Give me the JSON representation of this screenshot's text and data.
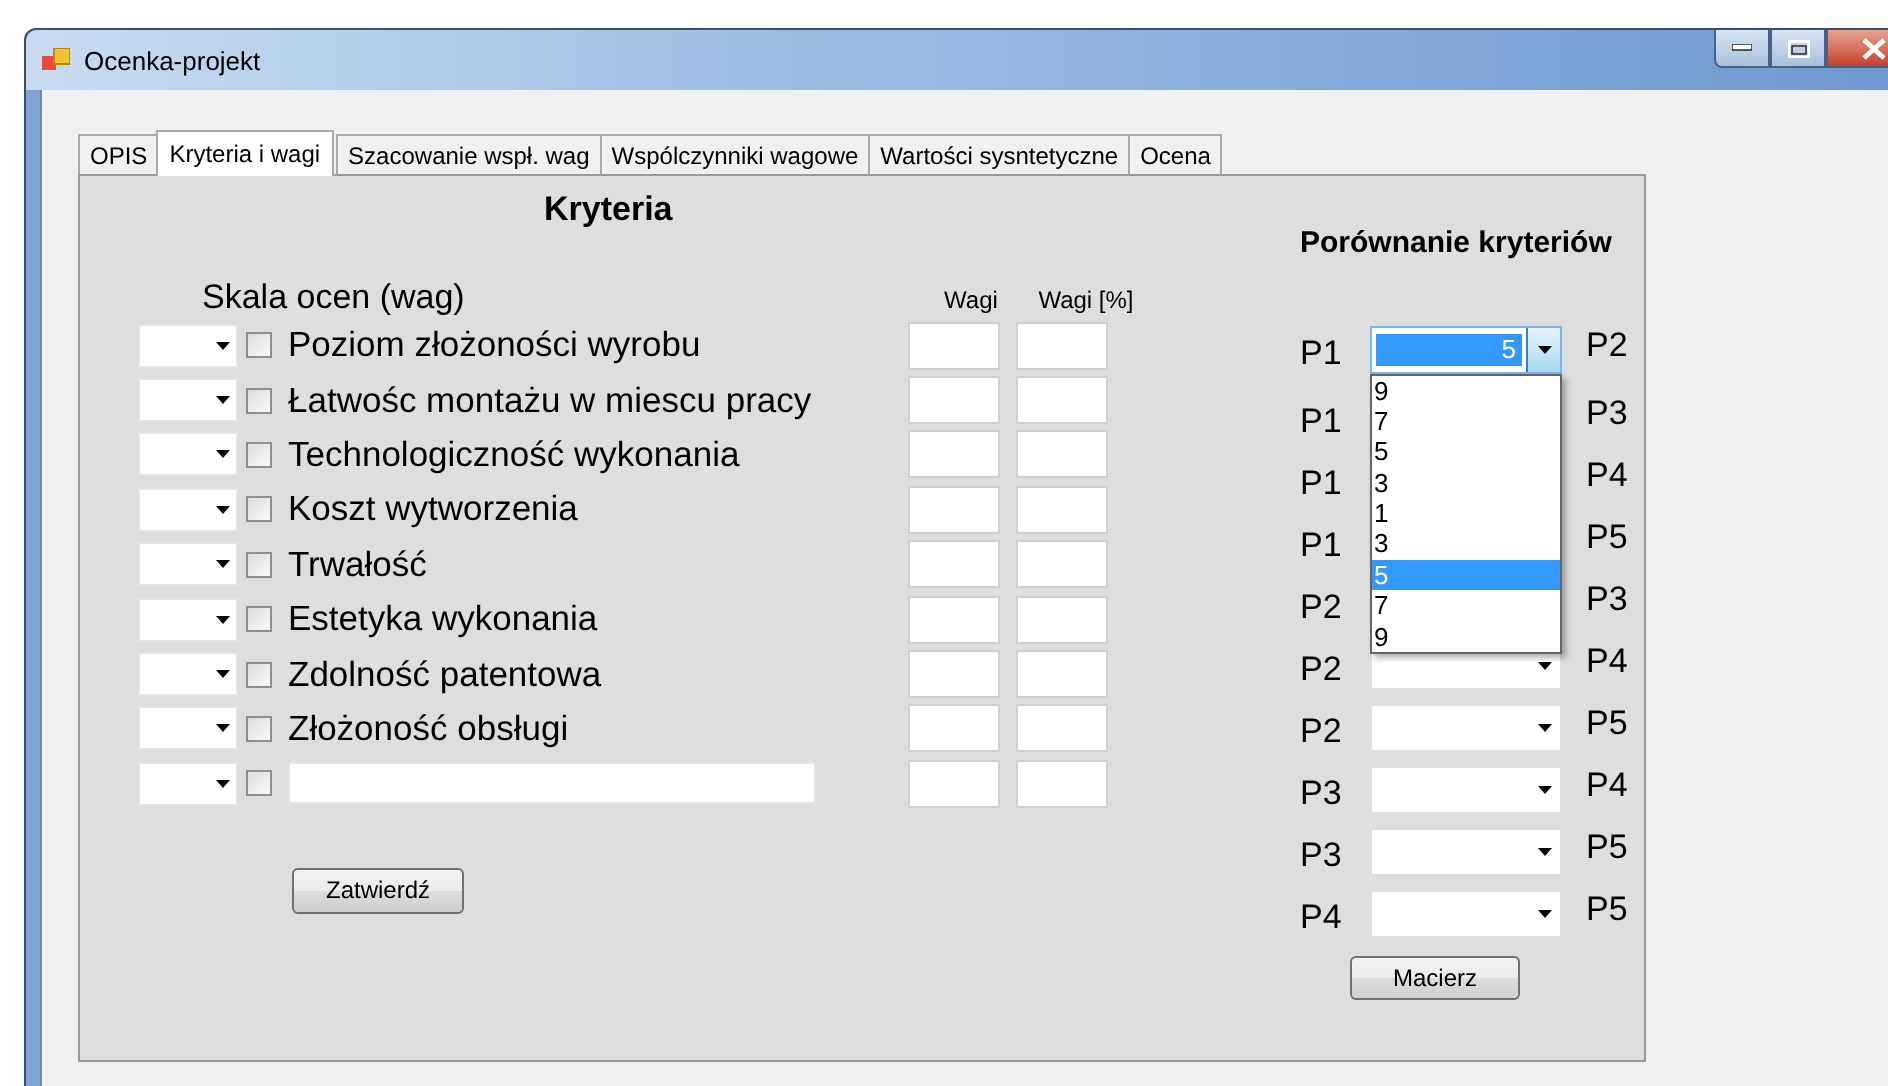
{
  "window": {
    "title": "Ocenka-projekt"
  },
  "tabs": [
    {
      "label": "OPIS",
      "selected": false
    },
    {
      "label": "Kryteria i wagi",
      "selected": true
    },
    {
      "label": "Szacowanie wspł. wag",
      "selected": false
    },
    {
      "label": "Wspólczynniki wagowe",
      "selected": false
    },
    {
      "label": "Wartości sysntetyczne",
      "selected": false
    },
    {
      "label": "Ocena",
      "selected": false
    }
  ],
  "criteria": {
    "heading": "Kryteria",
    "scale_label": "Skala ocen (wag)",
    "columns": [
      "Wagi",
      "Wagi [%]"
    ],
    "rows": [
      {
        "kind": "text",
        "label": "Poziom złożoności wyrobu",
        "checked": false
      },
      {
        "kind": "text",
        "label": "Łatwośc montażu w miescu pracy",
        "checked": false
      },
      {
        "kind": "text",
        "label": "Technologiczność wykonania",
        "checked": false
      },
      {
        "kind": "text",
        "label": "Koszt wytworzenia",
        "checked": false
      },
      {
        "kind": "text",
        "label": "Trwałość",
        "checked": false
      },
      {
        "kind": "text",
        "label": "Estetyka wykonania",
        "checked": false
      },
      {
        "kind": "text",
        "label": "Zdolność patentowa",
        "checked": false
      },
      {
        "kind": "text",
        "label": "Złożoność obsługi",
        "checked": false
      },
      {
        "kind": "input",
        "checked": false
      }
    ],
    "submit_button": "Zatwierdź"
  },
  "comparison": {
    "heading": "Porównanie kryteriów",
    "pairs": [
      {
        "left": "P1",
        "right": "P2",
        "value": "5",
        "open": true
      },
      {
        "left": "P1",
        "right": "P3",
        "open": false
      },
      {
        "left": "P1",
        "right": "P4",
        "open": false
      },
      {
        "left": "P1",
        "right": "P5",
        "open": false
      },
      {
        "left": "P2",
        "right": "P3",
        "open": false
      },
      {
        "left": "P2",
        "right": "P4",
        "open": false
      },
      {
        "left": "P2",
        "right": "P5",
        "open": false
      },
      {
        "left": "P3",
        "right": "P4",
        "open": false
      },
      {
        "left": "P3",
        "right": "P5",
        "open": false
      },
      {
        "left": "P4",
        "right": "P5",
        "open": false
      }
    ],
    "options": [
      {
        "label": "9",
        "selected": false
      },
      {
        "label": "7",
        "selected": false
      },
      {
        "label": "5",
        "selected": false
      },
      {
        "label": "3",
        "selected": false
      },
      {
        "label": "1",
        "selected": false
      },
      {
        "label": "3",
        "selected": false
      },
      {
        "label": "5",
        "selected": true
      },
      {
        "label": "7",
        "selected": false
      },
      {
        "label": "9",
        "selected": false
      }
    ],
    "matrix_button": "Macierz"
  }
}
